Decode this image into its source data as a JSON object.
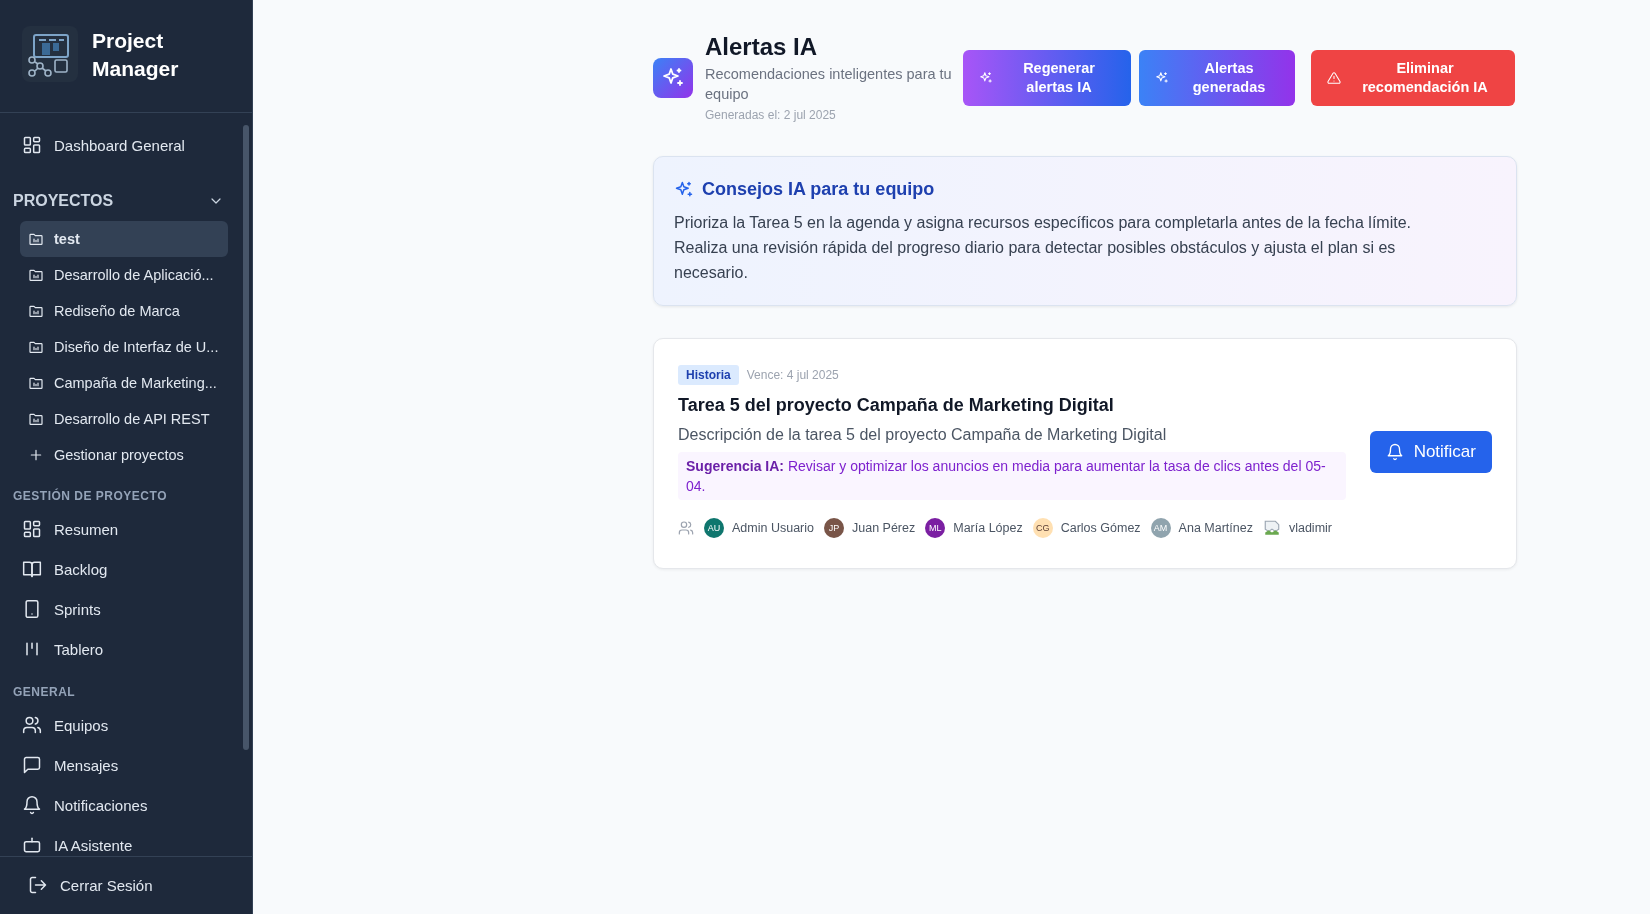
{
  "sidebar": {
    "app_name": "Project Manager",
    "top_items": [
      {
        "label": "Dashboard General",
        "kind": "grid",
        "selected": false
      }
    ],
    "projects_section": {
      "title": "PROYECTOS",
      "expanded": true,
      "items": [
        {
          "label": "test",
          "selected": true
        },
        {
          "label": "Desarrollo de Aplicació...",
          "selected": false
        },
        {
          "label": "Rediseño de Marca",
          "selected": false
        },
        {
          "label": "Diseño de Interfaz de U...",
          "selected": false
        },
        {
          "label": "Campaña de Marketing...",
          "selected": false
        },
        {
          "label": "Desarrollo de API REST",
          "selected": false
        }
      ],
      "manage_label": "Gestionar proyectos"
    },
    "sections": [
      {
        "title": "GESTIÓN DE PROYECTO",
        "items": [
          {
            "label": "Resumen",
            "kind": "grid"
          },
          {
            "label": "Backlog",
            "kind": "book"
          },
          {
            "label": "Sprints",
            "kind": "tablet"
          },
          {
            "label": "Tablero",
            "kind": "columns"
          }
        ]
      },
      {
        "title": "GENERAL",
        "items": [
          {
            "label": "Equipos",
            "kind": "users"
          },
          {
            "label": "Mensajes",
            "kind": "chat"
          },
          {
            "label": "Notificaciones",
            "kind": "bell"
          },
          {
            "label": "IA Asistente",
            "kind": "bot"
          }
        ]
      }
    ],
    "logout": "Cerrar Sesión"
  },
  "header": {
    "title": "Alertas IA",
    "subtitle": "Recomendaciones inteligentes para tu equipo",
    "generated": "Generadas el: 2 jul 2025",
    "buttons": [
      {
        "label": "Regenerar alertas IA",
        "kind": "regen"
      },
      {
        "label": "Alertas generadas",
        "kind": "generated"
      },
      {
        "label": "Eliminar recomendación IA",
        "kind": "danger"
      }
    ]
  },
  "advice": {
    "title": "Consejos IA para tu equipo",
    "text": "Prioriza la Tarea 5 en la agenda y asigna recursos específicos para completarla antes de la fecha límite. Realiza una revisión rápida del progreso diario para detectar posibles obstáculos y ajusta el plan si es necesario."
  },
  "tasks": [
    {
      "tag": "Historia",
      "due": "Vence: 4 jul 2025",
      "title": "Tarea 5 del proyecto Campaña de Marketing Digital",
      "description": "Descripción de la tarea 5 del proyecto Campaña de Marketing Digital",
      "suggestion": "**Sugerencia IA:** Revisar y optimizar los anuncios en media para aumentar la tasa de clics antes del 05-04.",
      "notify": "Notificar",
      "members": [
        {
          "kind": "initials",
          "initials": "AU",
          "name": "Admin Usuario",
          "color": "#0f766e"
        },
        {
          "kind": "initials",
          "initials": "JP",
          "name": "Juan Pérez",
          "color": "#795548"
        },
        {
          "kind": "initials",
          "initials": "ML",
          "name": "María López",
          "color": "#7b1fa2"
        },
        {
          "kind": "initials",
          "initials": "CG",
          "name": "Carlos Gómez",
          "color": "#ffe0b2"
        },
        {
          "kind": "initials",
          "initials": "AM",
          "name": "Ana Martínez",
          "color": "#90a4ae"
        },
        {
          "kind": "broken-image",
          "name": "vladimir"
        }
      ]
    }
  ]
}
